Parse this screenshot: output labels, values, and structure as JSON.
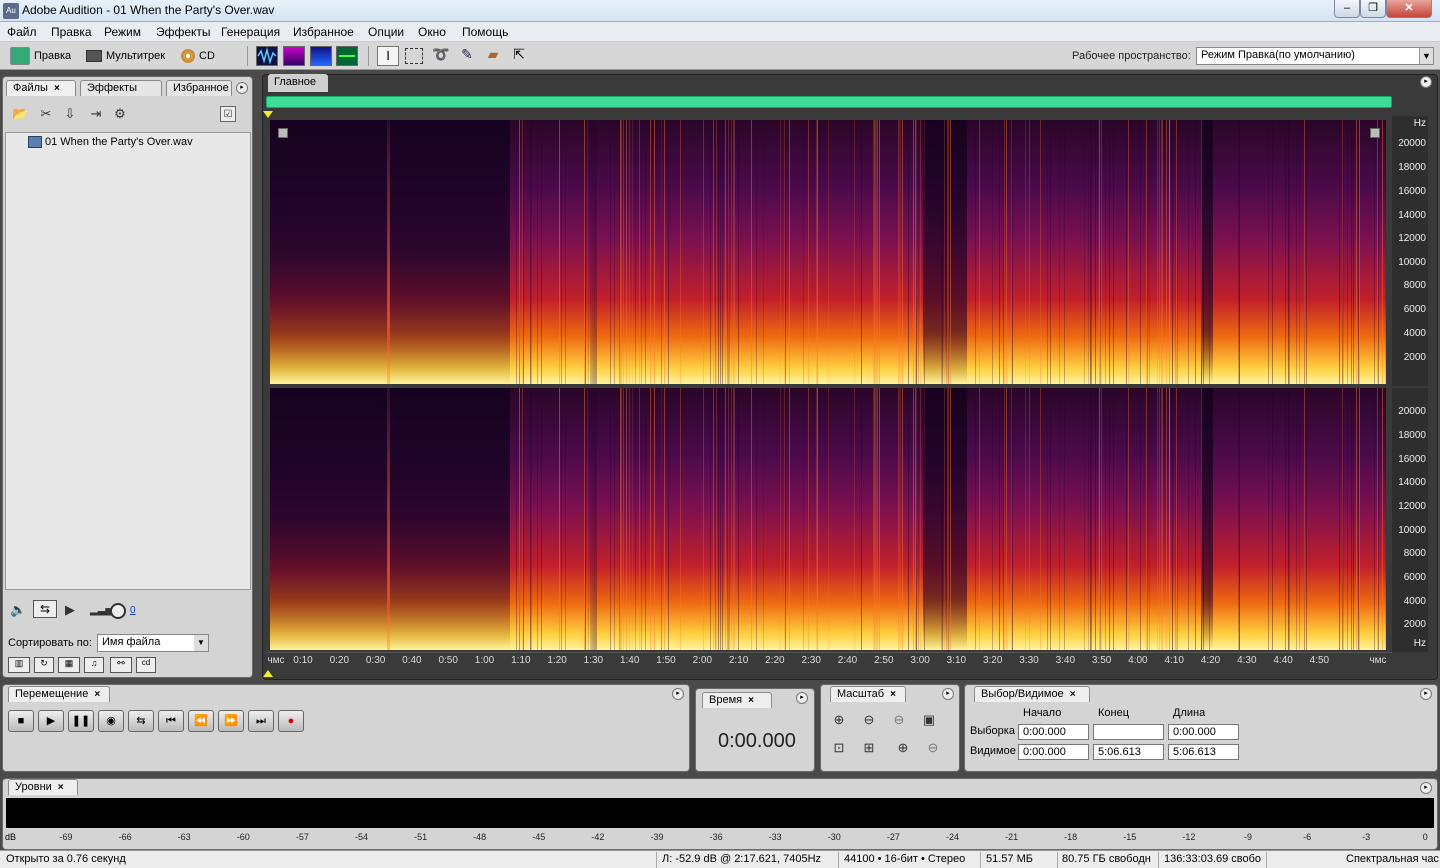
{
  "window": {
    "title": "Adobe Audition - 01 When the Party's Over.wav",
    "app_icon": "Au",
    "minimize": "‒",
    "maximize": "❐",
    "close": "✕"
  },
  "menu": [
    "Файл",
    "Правка",
    "Режим",
    "Эффекты",
    "Генерация",
    "Избранное",
    "Опции",
    "Окно",
    "Помощь"
  ],
  "toolbar": {
    "edit_mode": "Правка",
    "multitrack": "Мультитрек",
    "cd": "CD",
    "workspace_label": "Рабочее пространство:",
    "workspace_value": "Режим Правка(по умолчанию)"
  },
  "files_panel": {
    "tabs": [
      "Файлы",
      "Эффекты",
      "Избранное"
    ],
    "files": [
      "01 When the Party's Over.wav"
    ],
    "volume_value": "0",
    "sort_label": "Сортировать по:",
    "sort_value": "Имя файла"
  },
  "editor": {
    "tab": "Главное",
    "freq_unit": "Hz",
    "freq_labels": [
      "20000",
      "18000",
      "16000",
      "14000",
      "12000",
      "10000",
      "8000",
      "6000",
      "4000",
      "2000"
    ],
    "time_start": "чмс",
    "time_end": "чмс",
    "time_labels": [
      "0:10",
      "0:20",
      "0:30",
      "0:40",
      "0:50",
      "1:00",
      "1:10",
      "1:20",
      "1:30",
      "1:40",
      "1:50",
      "2:00",
      "2:10",
      "2:20",
      "2:30",
      "2:40",
      "2:50",
      "3:00",
      "3:10",
      "3:20",
      "3:30",
      "3:40",
      "3:50",
      "4:00",
      "4:10",
      "4:20",
      "4:30",
      "4:40",
      "4:50"
    ]
  },
  "transport": {
    "tab": "Перемещение"
  },
  "time_panel": {
    "tab": "Время",
    "value": "0:00.000"
  },
  "zoom_panel": {
    "tab": "Масштаб"
  },
  "selection_panel": {
    "tab": "Выбор/Видимое",
    "col_start": "Начало",
    "col_end": "Конец",
    "col_length": "Длина",
    "row_selection": "Выборка",
    "row_view": "Видимое",
    "sel_start": "0:00.000",
    "sel_end": "",
    "sel_length": "0:00.000",
    "view_start": "0:00.000",
    "view_end": "5:06.613",
    "view_length": "5:06.613"
  },
  "levels": {
    "tab": "Уровни",
    "unit": "dB",
    "scale": [
      "-69",
      "-66",
      "-63",
      "-60",
      "-57",
      "-54",
      "-51",
      "-48",
      "-45",
      "-42",
      "-39",
      "-36",
      "-33",
      "-30",
      "-27",
      "-24",
      "-21",
      "-18",
      "-15",
      "-12",
      "-9",
      "-6",
      "-3",
      "0"
    ]
  },
  "status": {
    "opened": "Открыто за 0.76 секунд",
    "cursor": "Л: -52.9 dB @   2:17.621, 7405Hz",
    "format": "44100 • 16-бит • Стерео",
    "size": "51.57 МБ",
    "free": "80.75 ГБ свободн",
    "free_time": "136:33:03.69 свобо",
    "view": "Спектральная час"
  }
}
